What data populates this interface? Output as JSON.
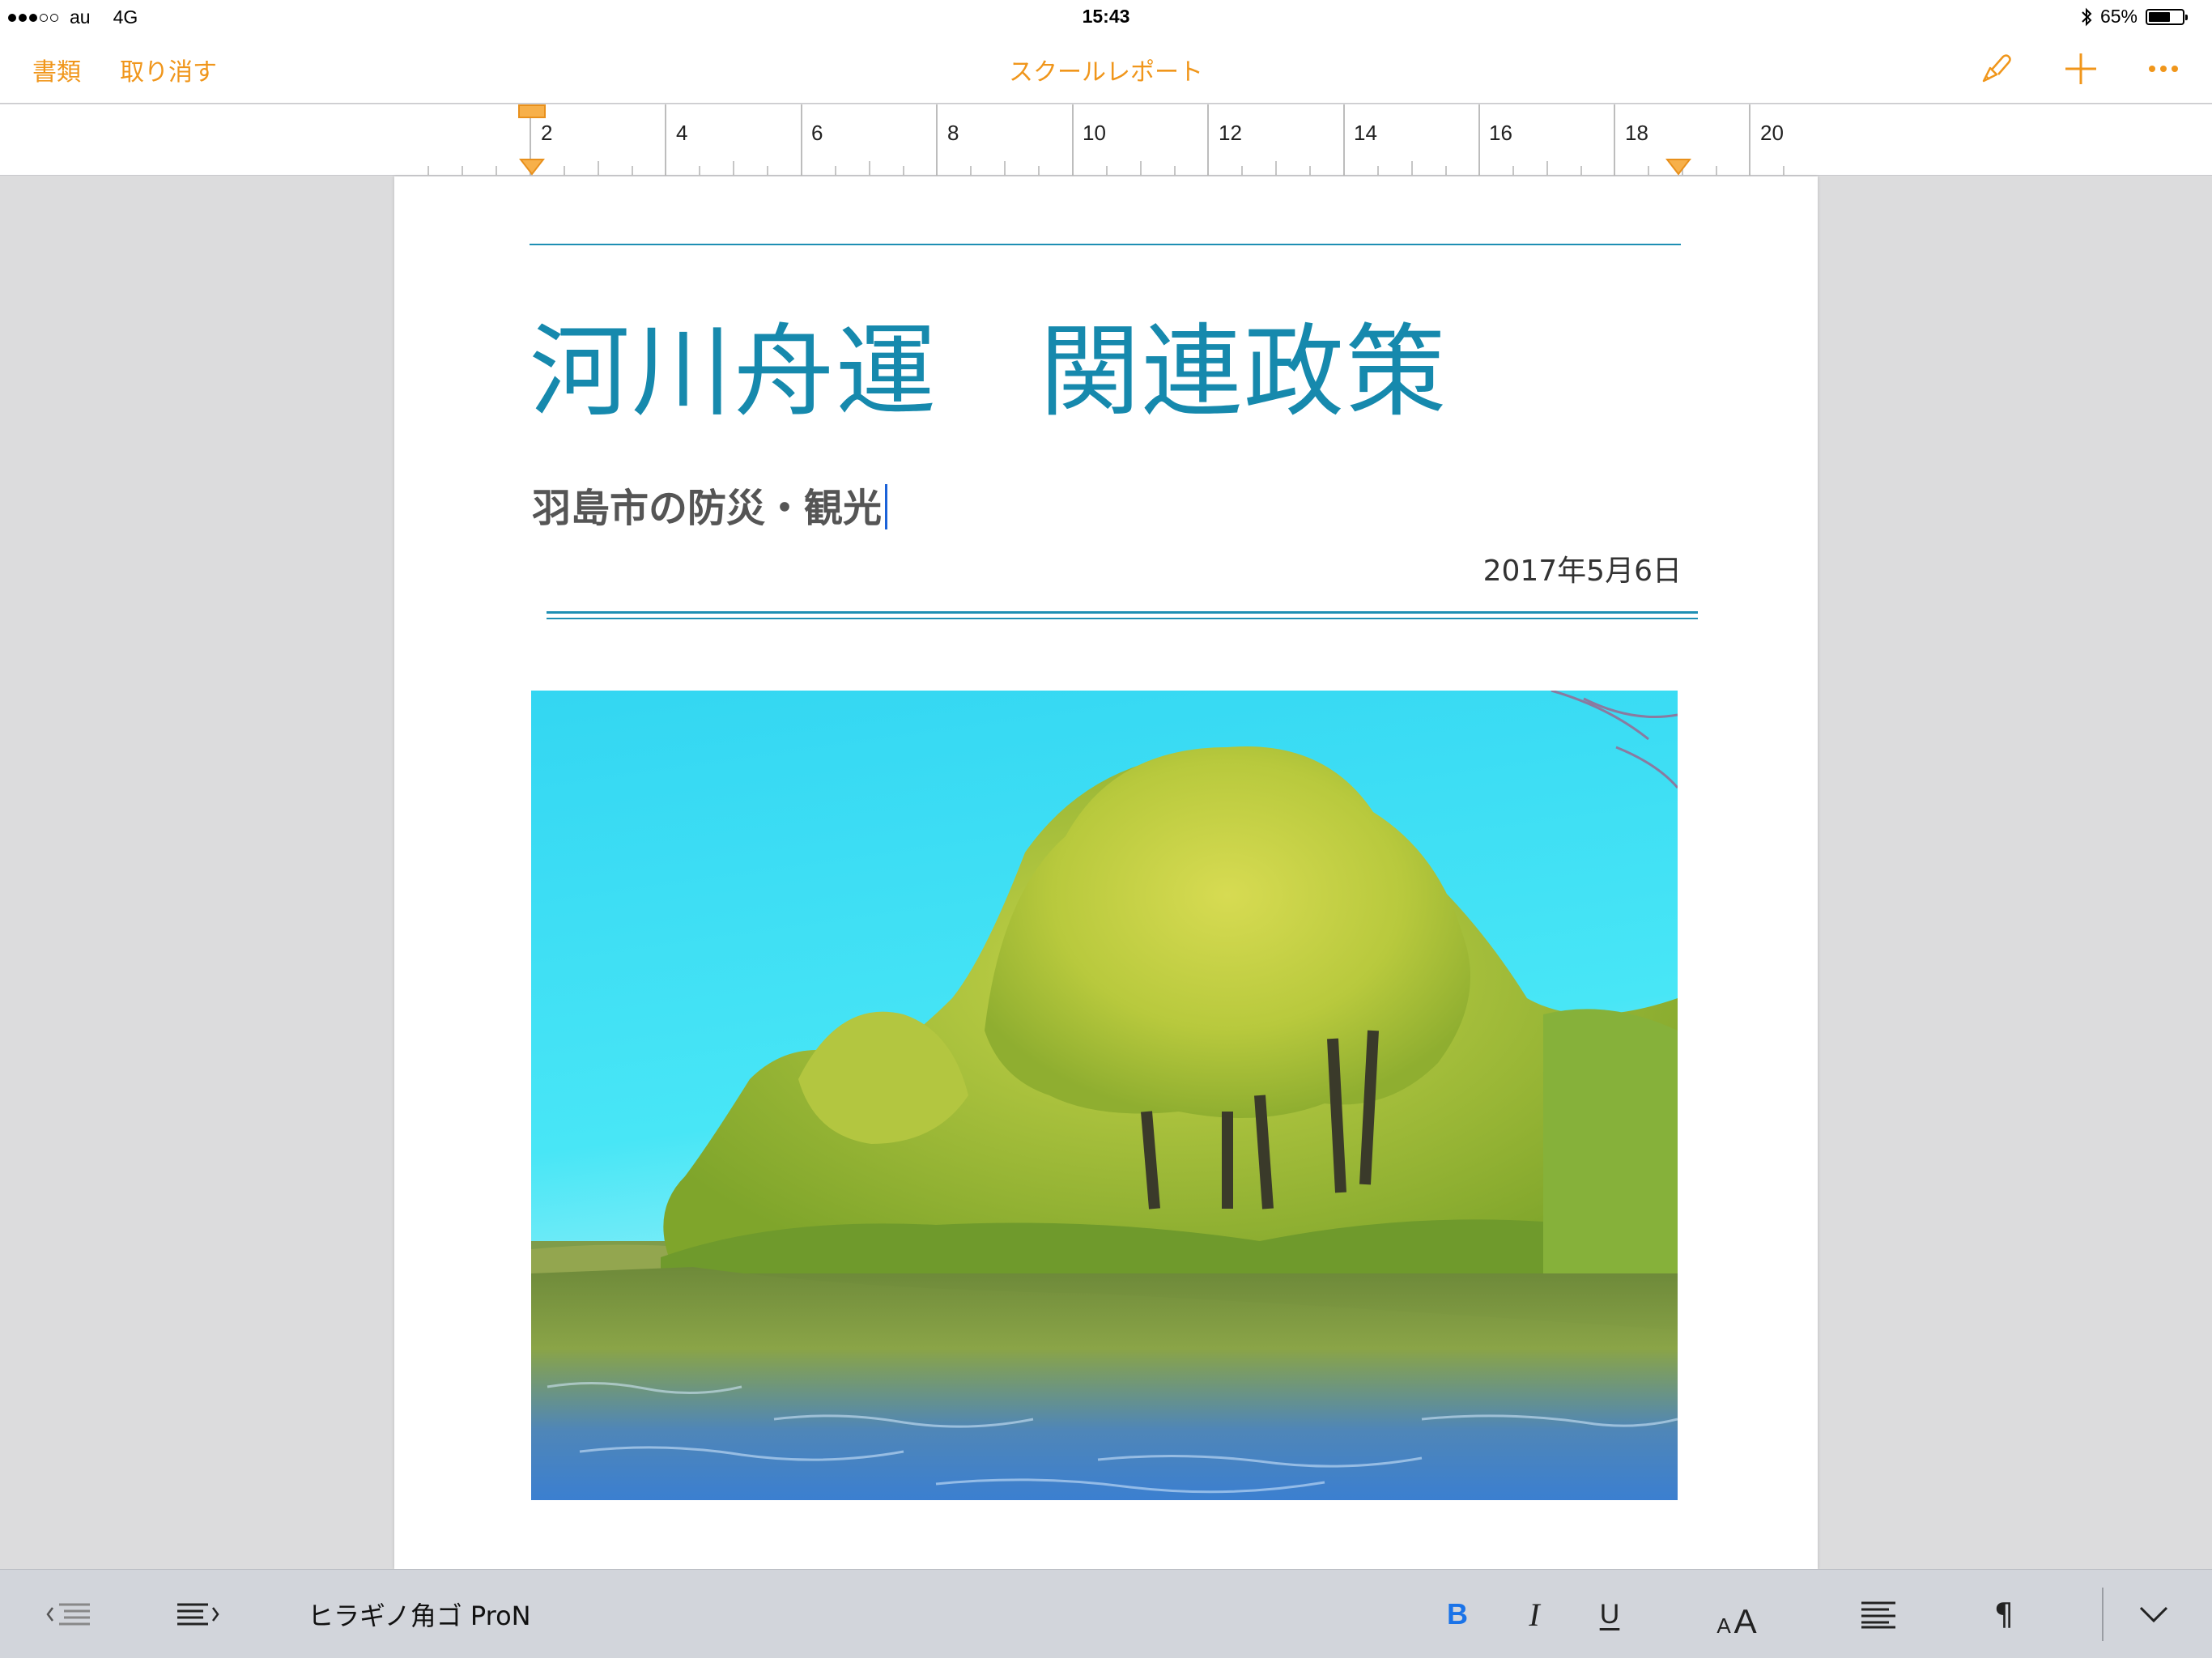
{
  "status_bar": {
    "carrier": "au",
    "network": "4G",
    "time": "15:43",
    "battery": "65%",
    "battery_level": 0.65
  },
  "toolbar": {
    "documents_label": "書類",
    "undo_label": "取り消す",
    "doc_name": "スクールレポート",
    "accent_color": "#f0961b"
  },
  "ruler": {
    "labels": [
      "2",
      "4",
      "6",
      "8",
      "10",
      "12",
      "14",
      "16",
      "18",
      "20"
    ]
  },
  "document": {
    "title": "河川舟運　関連政策",
    "subtitle": "羽島市の防災・観光",
    "date": "2017年5月6日",
    "title_color": "#1689ad",
    "image": "river-landscape-photo"
  },
  "format_bar": {
    "font_name": "ヒラギノ角ゴ ProN",
    "bold": "B",
    "italic": "I",
    "underline": "U",
    "font_size_small": "A",
    "font_size_large": "A",
    "paragraph_mark": "¶",
    "bold_color": "#1a73e8"
  }
}
